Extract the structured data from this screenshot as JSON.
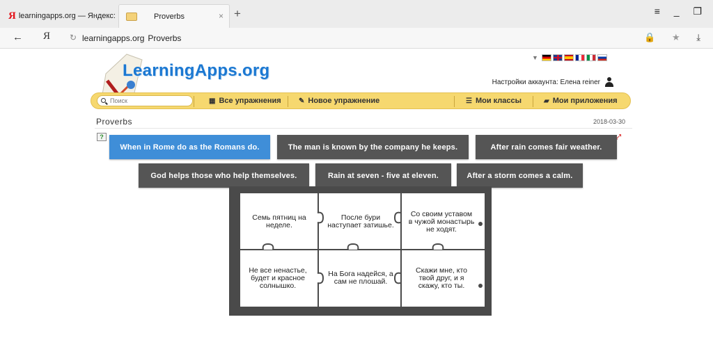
{
  "browser": {
    "tabs": [
      {
        "title": "learningapps.org — Яндекс:",
        "icon": "yandex-icon"
      },
      {
        "title": "Proverbs",
        "icon": "learningapps-favicon"
      }
    ],
    "new_tab": "+",
    "tab_close": "×",
    "window_controls": "≡ _ ❐",
    "address": {
      "back": "←",
      "home_glyph": "Я",
      "reload": "↻",
      "domain": "learningapps.org",
      "page_title": "Proverbs",
      "right_icons": "🔒 ★ ",
      "download": "⤓"
    }
  },
  "site": {
    "logo_text": "LearningApps.org",
    "account_label": "Настройки аккаунта: Елена reiner",
    "languages": [
      "de",
      "en",
      "es",
      "fr",
      "it",
      "ru"
    ],
    "search_placeholder": "Поиск",
    "nav": {
      "all_exercises": "Все упражнения",
      "new_exercise": "Новое упражнение",
      "my_classes": "Мои классы",
      "my_apps": "Мои приложения"
    }
  },
  "page": {
    "title": "Proverbs",
    "date": "2018-03-30",
    "help_glyph": "?",
    "fullscreen_glyph": "⤢"
  },
  "proverbs": [
    {
      "text": "When in Rome do as the Romans do.",
      "selected": true
    },
    {
      "text": "The man is known by the company he keeps.",
      "selected": false
    },
    {
      "text": "After rain comes fair weather.",
      "selected": false
    },
    {
      "text": "God helps those who help themselves.",
      "selected": false
    },
    {
      "text": "Rain at seven - five at eleven.",
      "selected": false
    },
    {
      "text": "After a storm comes a calm.",
      "selected": false
    }
  ],
  "puzzle": {
    "pieces": [
      "Семь пятниц на неделе.",
      "После бури наступает затишье.",
      "Со своим уставом в чужой монастырь не ходят.",
      "Не все ненастье, будет и красное солнышко.",
      "На Бога надейся, а сам не плошай.",
      "Скажи мне, кто твой друг, и я скажу, кто ты."
    ]
  },
  "colors": {
    "selected_button": "#3f8ed8",
    "button": "#555555",
    "navbar": "#f6d86f",
    "logo": "#1b78d2"
  }
}
